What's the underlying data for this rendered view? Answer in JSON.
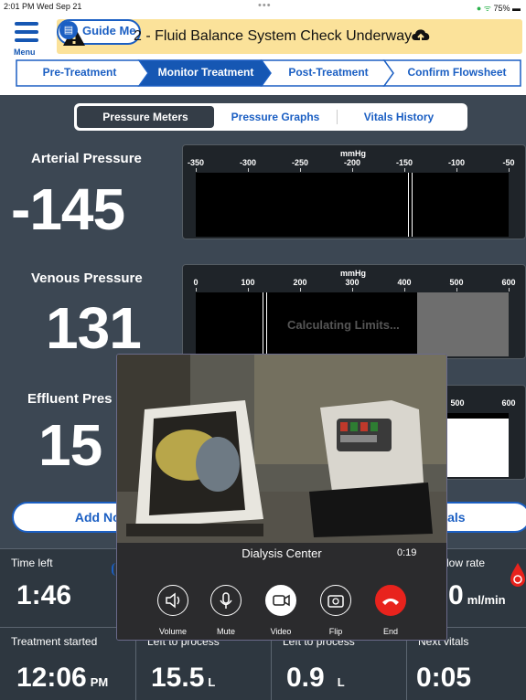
{
  "status": {
    "time": "2:01 PM  Wed Sep 21",
    "dots": "•••",
    "battery": "75%"
  },
  "header": {
    "menu_label": "Menu",
    "alert_text": "2 - Fluid Balance System Check Underway",
    "guide_label": "Guide Me"
  },
  "steps": [
    {
      "label": "Pre-Treatment",
      "active": false
    },
    {
      "label": "Monitor Treatment",
      "active": true
    },
    {
      "label": "Post-Treatment",
      "active": false
    },
    {
      "label": "Confirm Flowsheet",
      "active": false
    }
  ],
  "tabs": [
    {
      "label": "Pressure Meters",
      "active": true
    },
    {
      "label": "Pressure Graphs",
      "active": false
    },
    {
      "label": "Vitals History",
      "active": false
    }
  ],
  "meters": {
    "arterial": {
      "label": "Arterial Pressure",
      "value": "-145",
      "unit": "mmHg",
      "ticks": [
        "-350",
        "-300",
        "-250",
        "-200",
        "-150",
        "-100",
        "-50"
      ],
      "range": [
        -350,
        -50
      ],
      "reading": -145
    },
    "venous": {
      "label": "Venous Pressure",
      "value": "131",
      "unit": "mmHg",
      "ticks": [
        "0",
        "100",
        "200",
        "300",
        "400",
        "500",
        "600"
      ],
      "range": [
        0,
        600
      ],
      "reading": 131,
      "overlay_text": "Calculating Limits..."
    },
    "effluent": {
      "label": "Effluent Pres",
      "value": "15",
      "ticks": [
        "500",
        "600"
      ]
    }
  },
  "buttons": {
    "add_note": "Add Note",
    "vitals": "Vitals"
  },
  "tiles": {
    "time_left": {
      "label": "Time left",
      "value": "1:46"
    },
    "flow_rate": {
      "label": "low rate",
      "value": "0",
      "unit": "ml/min"
    },
    "treatment_started": {
      "label": "Treatment started",
      "value": "12:06",
      "suffix": "PM"
    },
    "left1": {
      "label": "Left to process",
      "value": "15.5",
      "unit": "L"
    },
    "left2": {
      "label": "Left to process",
      "value": "0.9",
      "unit": "L"
    },
    "next_vitals": {
      "label": "Next vitals",
      "value": "0:05"
    }
  },
  "video_call": {
    "caller": "Dialysis Center",
    "duration": "0:19",
    "controls": [
      "Volume",
      "Mute",
      "Video",
      "Flip",
      "End"
    ]
  },
  "colors": {
    "accent": "#1b5fc3",
    "alert": "#fbe29a",
    "end_call": "#e8231d",
    "background": "#3c4753"
  }
}
